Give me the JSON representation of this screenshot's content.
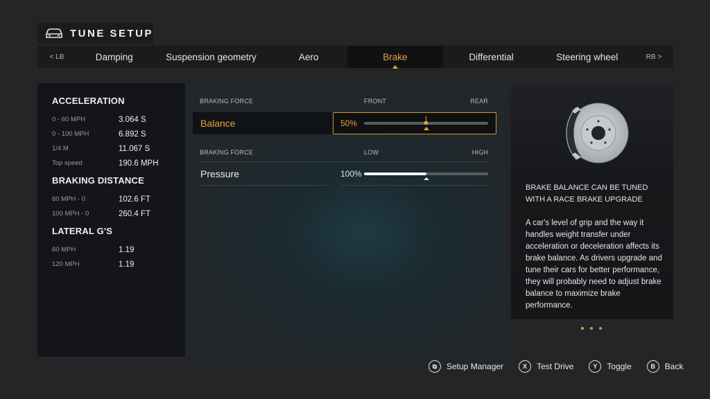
{
  "header": {
    "title": "TUNE SETUP",
    "icon": "car-icon"
  },
  "tabs": {
    "left_bumper": "< LB",
    "right_bumper": "RB >",
    "items": [
      {
        "label": "Damping",
        "active": false
      },
      {
        "label": "Suspension geometry",
        "active": false
      },
      {
        "label": "Aero",
        "active": false
      },
      {
        "label": "Brake",
        "active": true
      },
      {
        "label": "Differential",
        "active": false
      },
      {
        "label": "Steering wheel",
        "active": false
      }
    ]
  },
  "stats": {
    "acceleration": {
      "heading": "ACCELERATION",
      "rows": [
        {
          "label": "0 - 60 MPH",
          "value": "3.064 S"
        },
        {
          "label": "0 - 100 MPH",
          "value": "6.892 S"
        },
        {
          "label": "1/4 M",
          "value": "11.067 S"
        },
        {
          "label": "Top speed",
          "value": "190.6 MPH"
        }
      ]
    },
    "braking": {
      "heading": "BRAKING DISTANCE",
      "rows": [
        {
          "label": "60 MPH - 0",
          "value": "102.6 FT"
        },
        {
          "label": "100 MPH - 0",
          "value": "260.4 FT"
        }
      ]
    },
    "lateral": {
      "heading": "LATERAL G'S",
      "rows": [
        {
          "label": "60 MPH",
          "value": "1.19"
        },
        {
          "label": "120 MPH",
          "value": "1.19"
        }
      ]
    }
  },
  "settings": {
    "balance": {
      "section_label": "BRAKING FORCE",
      "min_label": "FRONT",
      "max_label": "REAR",
      "name": "Balance",
      "value_text": "50%",
      "value_fraction": 0.5,
      "default_fraction": 0.5,
      "selected": true
    },
    "pressure": {
      "section_label": "BRAKING FORCE",
      "min_label": "LOW",
      "max_label": "HIGH",
      "name": "Pressure",
      "value_text": "100%",
      "value_fraction": 0.5,
      "default_fraction": 0.5,
      "selected": false
    }
  },
  "info": {
    "image": "brake-disc-caliper",
    "title": "BRAKE BALANCE CAN BE TUNED WITH A RACE BRAKE UPGRADE",
    "body": "A car's level of grip and the way it handles weight transfer under acceleration or deceleration affects its brake balance. As drivers upgrade and tune their cars for better performance, they will probably need to adjust brake balance to maximize brake performance.",
    "page_count": 3,
    "page_active": 1
  },
  "footer": {
    "buttons": [
      {
        "glyph": "⧉",
        "label": "Setup Manager",
        "icon": "view-button-icon"
      },
      {
        "glyph": "X",
        "label": "Test Drive",
        "icon": "x-button-icon"
      },
      {
        "glyph": "Y",
        "label": "Toggle",
        "icon": "y-button-icon"
      },
      {
        "glyph": "B",
        "label": "Back",
        "icon": "b-button-icon"
      }
    ]
  },
  "colors": {
    "accent": "#e7a23b",
    "background": "#242527",
    "panel": "#131518"
  }
}
